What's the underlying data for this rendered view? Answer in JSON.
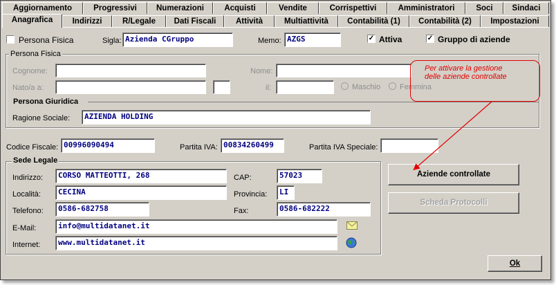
{
  "tabs_row1": [
    "Aggiornamento",
    "Progressivi",
    "Numerazioni",
    "Acquisti",
    "Vendite",
    "Corrispettivi",
    "Amministratori",
    "Soci",
    "Sindaci"
  ],
  "tabs_row2": [
    "Anagrafica",
    "Indirizzi",
    "R/Legale",
    "Dati Fiscali",
    "Attività",
    "Multiattività",
    "Contabilità (1)",
    "Contabilità (2)",
    "Impostazioni"
  ],
  "top": {
    "persona_fisica_label": "Persona Fisica",
    "persona_fisica_checked": false,
    "sigla_label": "Sigla:",
    "sigla_value": "Azienda CGruppo",
    "memo_label": "Memo:",
    "memo_value": "AZGS",
    "attiva_label": "Attiva",
    "attiva_checked": true,
    "gruppo_label": "Gruppo di aziende",
    "gruppo_checked": true
  },
  "persona_fisica": {
    "title": "Persona Fisica",
    "cognome_label": "Cognome:",
    "nome_label": "Nome:",
    "nato_label": "Nato/a a:",
    "il_label": "il:",
    "maschio_label": "Maschio",
    "femmina_label": "Femmina"
  },
  "persona_giuridica": {
    "title": "Persona Giuridica",
    "ragione_label": "Ragione Sociale:",
    "ragione_value": "AZIENDA HOLDING"
  },
  "fiscale": {
    "cf_label": "Codice Fiscale:",
    "cf_value": "00996090494",
    "piva_label": "Partita IVA:",
    "piva_value": "00834260499",
    "piva_speciale_label": "Partita IVA Speciale:",
    "piva_speciale_value": ""
  },
  "sede": {
    "title": "Sede Legale",
    "indirizzo_label": "Indirizzo:",
    "indirizzo_value": "CORSO MATTEOTTI, 268",
    "cap_label": "CAP:",
    "cap_value": "57023",
    "localita_label": "Località:",
    "localita_value": "CECINA",
    "provincia_label": "Provincia:",
    "provincia_value": "LI",
    "telefono_label": "Telefono:",
    "telefono_value": "0586-682758",
    "fax_label": "Fax:",
    "fax_value": "0586-682222",
    "email_label": "E-Mail:",
    "email_value": "info@multidatanet.it",
    "internet_label": "Internet:",
    "internet_value": "www.multidatanet.it"
  },
  "buttons": {
    "aziende_controllate": "Aziende controllate",
    "scheda_protocolli": "Scheda Protocolli",
    "ok": "Ok"
  },
  "annotation": {
    "line1": "Per attivare la gestione",
    "line2": "delle aziende controllate"
  },
  "colors": {
    "dialog_bg": "#d4d0c8",
    "field_text": "#000080",
    "annotation_red": "#e00000"
  }
}
